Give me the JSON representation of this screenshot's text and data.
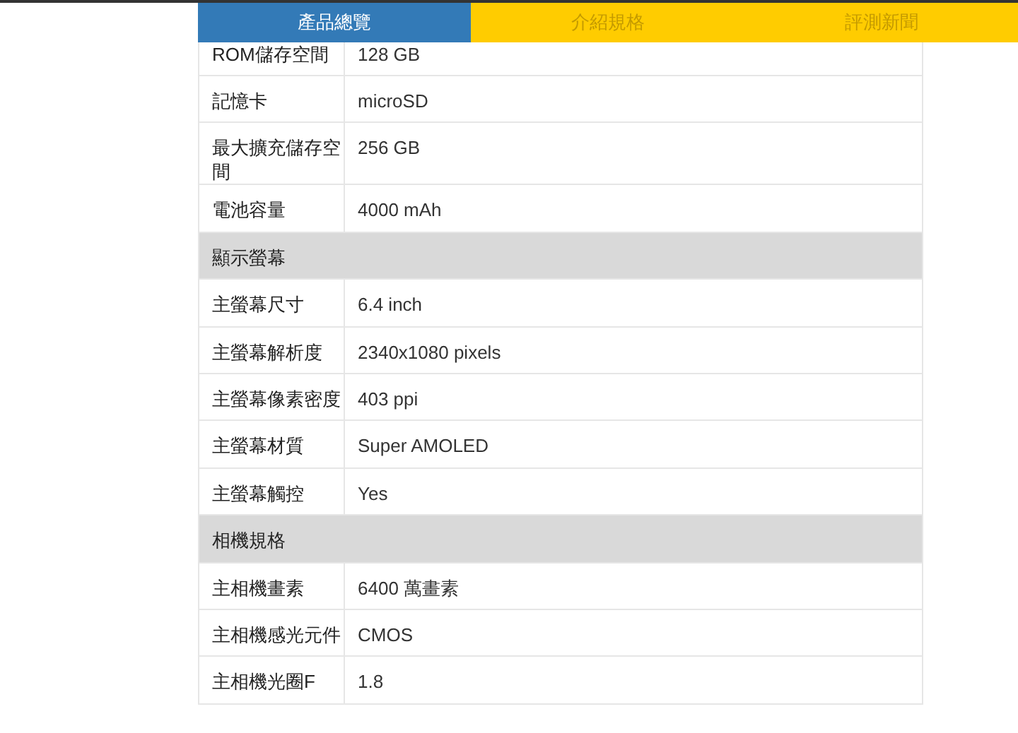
{
  "tabs": [
    {
      "label": "產品總覽",
      "selected": true
    },
    {
      "label": "介紹規格",
      "selected": false
    },
    {
      "label": "評測新聞",
      "selected": false
    }
  ],
  "spec_table": {
    "rows": [
      {
        "kind": "row",
        "label": "ROM儲存空間",
        "value": "128 GB"
      },
      {
        "kind": "row",
        "label": "記憶卡",
        "value": "microSD"
      },
      {
        "kind": "row",
        "label": "最大擴充儲存空間",
        "value": "256 GB"
      },
      {
        "kind": "row",
        "label": "電池容量",
        "value": "4000 mAh"
      },
      {
        "kind": "section",
        "label": "顯示螢幕"
      },
      {
        "kind": "row",
        "label": "主螢幕尺寸",
        "value": "6.4 inch"
      },
      {
        "kind": "row",
        "label": "主螢幕解析度",
        "value": "2340x1080 pixels"
      },
      {
        "kind": "row",
        "label": "主螢幕像素密度",
        "value": "403 ppi"
      },
      {
        "kind": "row",
        "label": "主螢幕材質",
        "value": "Super AMOLED"
      },
      {
        "kind": "row",
        "label": "主螢幕觸控",
        "value": "Yes"
      },
      {
        "kind": "section",
        "label": "相機規格"
      },
      {
        "kind": "row",
        "label": "主相機畫素",
        "value": "6400 萬畫素"
      },
      {
        "kind": "row",
        "label": "主相機感光元件",
        "value": "CMOS"
      },
      {
        "kind": "row",
        "label": "主相機光圈F",
        "value": "1.8"
      }
    ]
  }
}
